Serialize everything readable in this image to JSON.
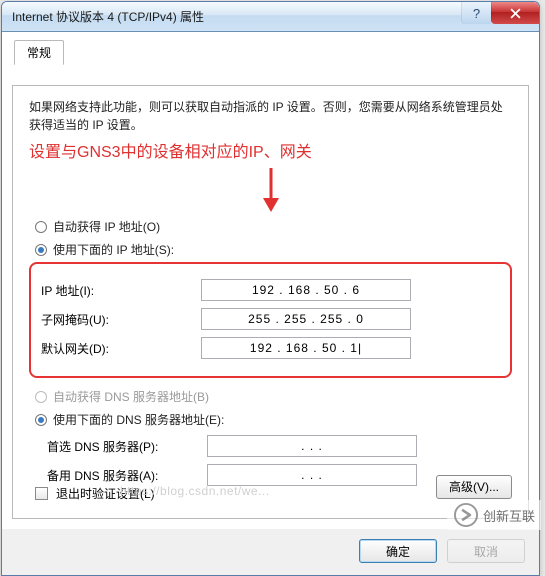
{
  "window": {
    "title": "Internet 协议版本 4 (TCP/IPv4) 属性"
  },
  "tab": {
    "label": "常规"
  },
  "description": "如果网络支持此功能，则可以获取自动指派的 IP 设置。否则，您需要从网络系统管理员处获得适当的 IP 设置。",
  "annotation": "设置与GNS3中的设备相对应的IP、网关",
  "ip": {
    "auto_label": "自动获得 IP 地址(O)",
    "manual_label": "使用下面的 IP 地址(S):",
    "selected": "manual",
    "fields": {
      "address_label": "IP 地址(I):",
      "address_value": "192 . 168 . 50  .  6",
      "mask_label": "子网掩码(U):",
      "mask_value": "255 . 255 . 255 .  0",
      "gateway_label": "默认网关(D):",
      "gateway_value": "192 . 168 . 50  .  1|"
    }
  },
  "dns": {
    "auto_label": "自动获得 DNS 服务器地址(B)",
    "manual_label": "使用下面的 DNS 服务器地址(E):",
    "selected": "manual",
    "fields": {
      "preferred_label": "首选 DNS 服务器(P):",
      "preferred_value": ".       .       .",
      "alternate_label": "备用 DNS 服务器(A):",
      "alternate_value": ".       .       ."
    }
  },
  "validate_label": "退出时验证设置(L)",
  "advanced_label": "高级(V)...",
  "ok_label": "确定",
  "cancel_label": "取消",
  "watermark": {
    "brand": "创新互联",
    "url": "https://blog.csdn.net/we..."
  }
}
